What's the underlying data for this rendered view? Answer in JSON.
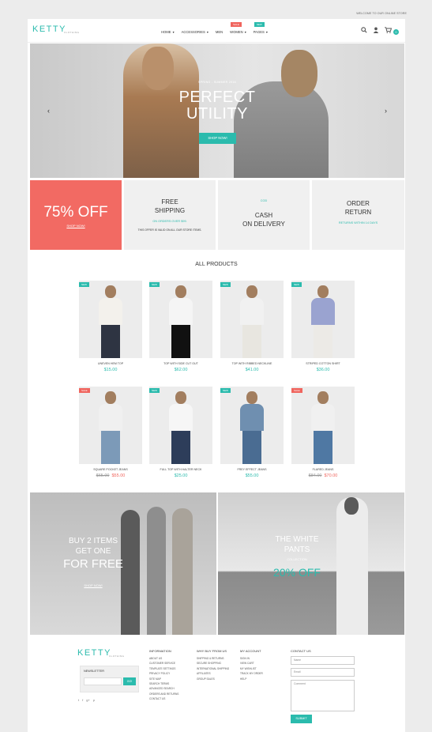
{
  "welcome": "Welcome to our online store",
  "header": {
    "logo": "KETTY",
    "logo_sub": "CLOTHING",
    "nav": [
      {
        "label": "Home",
        "chevron": true,
        "flag": ""
      },
      {
        "label": "Accessories",
        "chevron": true,
        "flag": ""
      },
      {
        "label": "Men",
        "chevron": false,
        "flag": ""
      },
      {
        "label": "Women",
        "chevron": true,
        "flag": "Sale"
      },
      {
        "label": "Pages",
        "chevron": true,
        "flag": "New"
      }
    ],
    "icons": [
      "search-icon",
      "user-icon",
      "cart-icon"
    ],
    "cart_count": "0"
  },
  "hero": {
    "kicker": "SPRING - SUMMER 2016",
    "title_line1": "PERFECT",
    "title_line2": "UTILITY",
    "button": "Shop now!",
    "prev": "‹",
    "next": "›"
  },
  "features": {
    "promo": {
      "big": "75% OFF",
      "link": "Shop now!"
    },
    "shipping": {
      "title_line1": "Free",
      "title_line2": "Shipping",
      "sub": "On orders over $99.",
      "note": "This offer is valid on all our store items."
    },
    "cod": {
      "sub": "COD",
      "title_line1": "Cash",
      "title_line2": "on Delivery"
    },
    "returns": {
      "title_line1": "Order",
      "title_line2": "Return",
      "sub": "Returns within 14 days"
    }
  },
  "products_title": "All Products",
  "products": [
    {
      "name": "Uneven hem top",
      "price": "$15.00",
      "old": "",
      "badge": "New"
    },
    {
      "name": "Top with side cut out",
      "price": "$62.00",
      "old": "",
      "badge": "New"
    },
    {
      "name": "Top with ribbed neckline",
      "price": "$41.00",
      "old": "",
      "badge": "New"
    },
    {
      "name": "Striped cotton shirt",
      "price": "$36.00",
      "old": "",
      "badge": "New"
    },
    {
      "name": "Square pocket jeans",
      "price": "$55.00",
      "old": "$65.00",
      "badge": "Sale"
    },
    {
      "name": "Full top with halter neck",
      "price": "$25.00",
      "old": "",
      "badge": "New"
    },
    {
      "name": "Frey effect jeans",
      "price": "$55.00",
      "old": "",
      "badge": "New"
    },
    {
      "name": "Flared jeans",
      "price": "$70.00",
      "old": "$84.00",
      "badge": "Sale"
    }
  ],
  "banner1": {
    "line1": "Buy 2 items",
    "line2": "get one",
    "line3": "for free",
    "link": "Shop now!"
  },
  "banner2": {
    "line1": "The white",
    "line2": "pants",
    "line3": "Collection",
    "line4": "20% OFF"
  },
  "footer": {
    "logo": "KETTY",
    "logo_sub": "CLOTHING",
    "newsletter_label": "Newsletter",
    "newsletter_button": "Go!",
    "social": [
      "t",
      "f",
      "g+",
      "p"
    ],
    "col1": {
      "heading": "Information",
      "links": [
        "About us",
        "Customer Service",
        "Template Settings",
        "Privacy Policy",
        "Site Map",
        "Search Terms",
        "Advanced Search",
        "Orders and Returns",
        "Contact Us"
      ]
    },
    "col2": {
      "heading": "Why buy from us",
      "links": [
        "Shipping & Returns",
        "Secure Shopping",
        "International Shipping",
        "Affiliates",
        "Group Sales"
      ]
    },
    "col3": {
      "heading": "My account",
      "links": [
        "Sign In",
        "View Cart",
        "My Wishlist",
        "Track My Order",
        "Help"
      ]
    },
    "contact": {
      "heading": "Contact us",
      "name": "Name",
      "email": "Email",
      "comment": "Comment",
      "submit": "Submit"
    }
  }
}
